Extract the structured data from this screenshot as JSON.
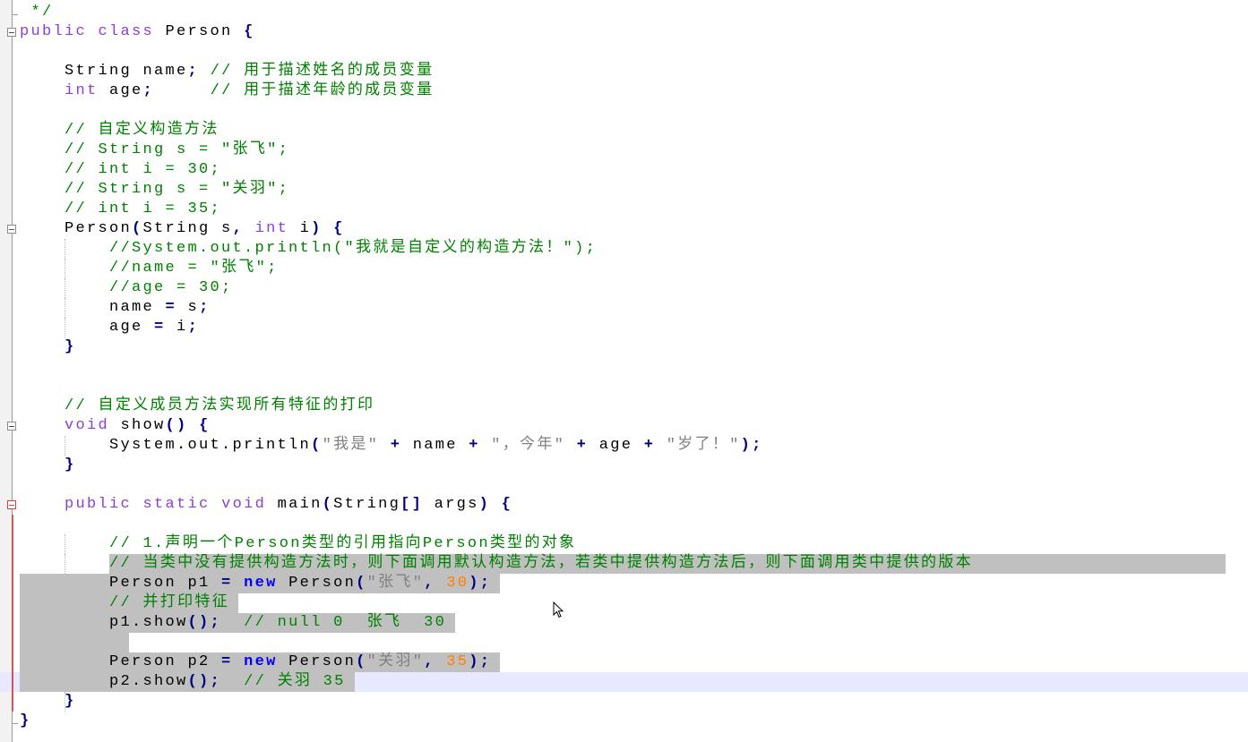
{
  "editor": {
    "colors": {
      "keyword": "#8a3fd1",
      "new_keyword": "#0000ff",
      "operator": "#000080",
      "comment": "#008000",
      "string": "#808080",
      "number": "#ff8000",
      "selection": "#c0c0c0",
      "current_line": "#e8e8ff"
    },
    "lines": [
      {
        "tokens": [
          {
            "t": "c",
            "v": " */"
          }
        ]
      },
      {
        "tokens": [
          {
            "t": "k",
            "v": "public"
          },
          {
            "t": "t",
            "v": " "
          },
          {
            "t": "k",
            "v": "class"
          },
          {
            "t": "t",
            "v": " Person "
          },
          {
            "t": "o",
            "v": "{"
          }
        ]
      },
      {
        "tokens": []
      },
      {
        "tokens": [
          {
            "t": "t",
            "v": "    String name"
          },
          {
            "t": "o",
            "v": ";"
          },
          {
            "t": "t",
            "v": " "
          },
          {
            "t": "c",
            "v": "// 用于描述姓名的成员变量"
          }
        ]
      },
      {
        "tokens": [
          {
            "t": "t",
            "v": "    "
          },
          {
            "t": "k",
            "v": "int"
          },
          {
            "t": "t",
            "v": " age"
          },
          {
            "t": "o",
            "v": ";"
          },
          {
            "t": "t",
            "v": "     "
          },
          {
            "t": "c",
            "v": "// 用于描述年龄的成员变量"
          }
        ]
      },
      {
        "tokens": []
      },
      {
        "tokens": [
          {
            "t": "t",
            "v": "    "
          },
          {
            "t": "c",
            "v": "// 自定义构造方法"
          }
        ]
      },
      {
        "tokens": [
          {
            "t": "t",
            "v": "    "
          },
          {
            "t": "c",
            "v": "// String s = \"张飞\";"
          }
        ]
      },
      {
        "tokens": [
          {
            "t": "t",
            "v": "    "
          },
          {
            "t": "c",
            "v": "// int i = 30;"
          }
        ]
      },
      {
        "tokens": [
          {
            "t": "t",
            "v": "    "
          },
          {
            "t": "c",
            "v": "// String s = \"关羽\";"
          }
        ]
      },
      {
        "tokens": [
          {
            "t": "t",
            "v": "    "
          },
          {
            "t": "c",
            "v": "// int i = 35;"
          }
        ]
      },
      {
        "tokens": [
          {
            "t": "t",
            "v": "    Person"
          },
          {
            "t": "o",
            "v": "("
          },
          {
            "t": "t",
            "v": "String s"
          },
          {
            "t": "o",
            "v": ","
          },
          {
            "t": "t",
            "v": " "
          },
          {
            "t": "k",
            "v": "int"
          },
          {
            "t": "t",
            "v": " i"
          },
          {
            "t": "o",
            "v": ")"
          },
          {
            "t": "t",
            "v": " "
          },
          {
            "t": "o",
            "v": "{"
          }
        ]
      },
      {
        "tokens": [
          {
            "t": "t",
            "v": "        "
          },
          {
            "t": "c",
            "v": "//System.out.println(\"我就是自定义的构造方法！\");"
          }
        ]
      },
      {
        "tokens": [
          {
            "t": "t",
            "v": "        "
          },
          {
            "t": "c",
            "v": "//name = \"张飞\";"
          }
        ]
      },
      {
        "tokens": [
          {
            "t": "t",
            "v": "        "
          },
          {
            "t": "c",
            "v": "//age = 30;"
          }
        ]
      },
      {
        "tokens": [
          {
            "t": "t",
            "v": "        name "
          },
          {
            "t": "o",
            "v": "="
          },
          {
            "t": "t",
            "v": " s"
          },
          {
            "t": "o",
            "v": ";"
          }
        ]
      },
      {
        "tokens": [
          {
            "t": "t",
            "v": "        age "
          },
          {
            "t": "o",
            "v": "="
          },
          {
            "t": "t",
            "v": " i"
          },
          {
            "t": "o",
            "v": ";"
          }
        ]
      },
      {
        "tokens": [
          {
            "t": "t",
            "v": "    "
          },
          {
            "t": "o",
            "v": "}"
          }
        ]
      },
      {
        "tokens": []
      },
      {
        "tokens": []
      },
      {
        "tokens": [
          {
            "t": "t",
            "v": "    "
          },
          {
            "t": "c",
            "v": "// 自定义成员方法实现所有特征的打印"
          }
        ]
      },
      {
        "tokens": [
          {
            "t": "t",
            "v": "    "
          },
          {
            "t": "k",
            "v": "void"
          },
          {
            "t": "t",
            "v": " show"
          },
          {
            "t": "o",
            "v": "()"
          },
          {
            "t": "t",
            "v": " "
          },
          {
            "t": "o",
            "v": "{"
          }
        ]
      },
      {
        "tokens": [
          {
            "t": "t",
            "v": "        System.out.println"
          },
          {
            "t": "o",
            "v": "("
          },
          {
            "t": "s",
            "v": "\"我是\""
          },
          {
            "t": "t",
            "v": " "
          },
          {
            "t": "o",
            "v": "+"
          },
          {
            "t": "t",
            "v": " name "
          },
          {
            "t": "o",
            "v": "+"
          },
          {
            "t": "t",
            "v": " "
          },
          {
            "t": "s",
            "v": "\"，今年\""
          },
          {
            "t": "t",
            "v": " "
          },
          {
            "t": "o",
            "v": "+"
          },
          {
            "t": "t",
            "v": " age "
          },
          {
            "t": "o",
            "v": "+"
          },
          {
            "t": "t",
            "v": " "
          },
          {
            "t": "s",
            "v": "\"岁了！\""
          },
          {
            "t": "o",
            "v": ");"
          }
        ]
      },
      {
        "tokens": [
          {
            "t": "t",
            "v": "    "
          },
          {
            "t": "o",
            "v": "}"
          }
        ]
      },
      {
        "tokens": []
      },
      {
        "tokens": [
          {
            "t": "t",
            "v": "    "
          },
          {
            "t": "k",
            "v": "public"
          },
          {
            "t": "t",
            "v": " "
          },
          {
            "t": "k",
            "v": "static"
          },
          {
            "t": "t",
            "v": " "
          },
          {
            "t": "k",
            "v": "void"
          },
          {
            "t": "t",
            "v": " main"
          },
          {
            "t": "o",
            "v": "("
          },
          {
            "t": "t",
            "v": "String"
          },
          {
            "t": "o",
            "v": "[]"
          },
          {
            "t": "t",
            "v": " args"
          },
          {
            "t": "o",
            "v": ")"
          },
          {
            "t": "t",
            "v": " "
          },
          {
            "t": "o",
            "v": "{"
          }
        ]
      },
      {
        "tokens": []
      },
      {
        "tokens": [
          {
            "t": "t",
            "v": "        "
          },
          {
            "t": "c",
            "v": "// 1.声明一个Person类型的引用指向Person类型的对象"
          }
        ]
      },
      {
        "tokens": [
          {
            "t": "t",
            "v": "        "
          },
          {
            "t": "c",
            "v": "// 当类中没有提供构造方法时，则下面调用默认构造方法，若类中提供构造方法后，则下面调用类中提供的版本"
          }
        ]
      },
      {
        "tokens": [
          {
            "t": "t",
            "v": "        Person p1 "
          },
          {
            "t": "o",
            "v": "="
          },
          {
            "t": "t",
            "v": " "
          },
          {
            "t": "n",
            "v": "new"
          },
          {
            "t": "t",
            "v": " Person"
          },
          {
            "t": "o",
            "v": "("
          },
          {
            "t": "s",
            "v": "\"张飞\""
          },
          {
            "t": "o",
            "v": ","
          },
          {
            "t": "t",
            "v": " "
          },
          {
            "t": "d",
            "v": "30"
          },
          {
            "t": "o",
            "v": ");"
          }
        ]
      },
      {
        "tokens": [
          {
            "t": "t",
            "v": "        "
          },
          {
            "t": "c",
            "v": "// 并打印特征"
          }
        ]
      },
      {
        "tokens": [
          {
            "t": "t",
            "v": "        p1.show"
          },
          {
            "t": "o",
            "v": "();"
          },
          {
            "t": "t",
            "v": "  "
          },
          {
            "t": "c",
            "v": "// null 0  张飞  30"
          }
        ]
      },
      {
        "tokens": []
      },
      {
        "tokens": [
          {
            "t": "t",
            "v": "        Person p2 "
          },
          {
            "t": "o",
            "v": "="
          },
          {
            "t": "t",
            "v": " "
          },
          {
            "t": "n",
            "v": "new"
          },
          {
            "t": "t",
            "v": " Person"
          },
          {
            "t": "o",
            "v": "("
          },
          {
            "t": "s",
            "v": "\"关羽\""
          },
          {
            "t": "o",
            "v": ","
          },
          {
            "t": "t",
            "v": " "
          },
          {
            "t": "d",
            "v": "35"
          },
          {
            "t": "o",
            "v": ");"
          }
        ]
      },
      {
        "tokens": [
          {
            "t": "t",
            "v": "        p2.show"
          },
          {
            "t": "o",
            "v": "();"
          },
          {
            "t": "t",
            "v": "  "
          },
          {
            "t": "c",
            "v": "// 关羽 35"
          }
        ]
      },
      {
        "tokens": [
          {
            "t": "t",
            "v": "    "
          },
          {
            "t": "o",
            "v": "}"
          }
        ]
      },
      {
        "tokens": [
          {
            "t": "o",
            "v": "}"
          }
        ]
      }
    ]
  }
}
